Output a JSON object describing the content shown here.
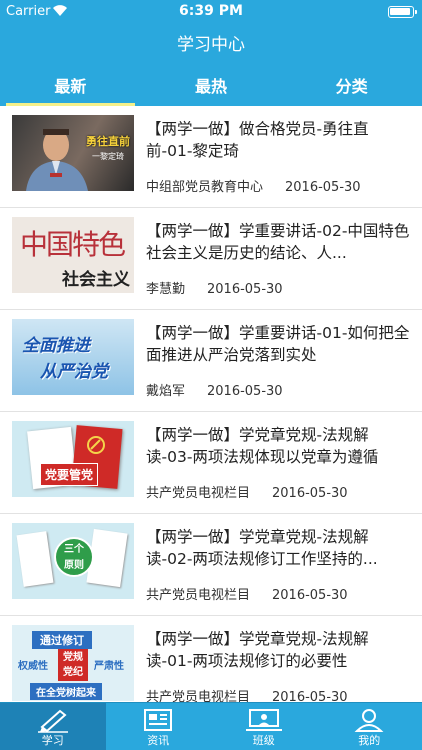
{
  "status_bar": {
    "carrier": "Carrier",
    "time": "6:39 PM"
  },
  "nav": {
    "title": "学习中心"
  },
  "tabs": [
    {
      "label": "最新",
      "active": true
    },
    {
      "label": "最热",
      "active": false
    },
    {
      "label": "分类",
      "active": false
    }
  ],
  "thumbnails": {
    "t1": {
      "text": "勇往直前",
      "sub": "一黎定琦"
    },
    "t2": {
      "text": "中国特色",
      "sub": "社会主义"
    },
    "t3": {
      "line1": "全面推进",
      "line2": "从严治党"
    },
    "t4": {
      "badge": "党要管党"
    },
    "t5": {
      "badge_top": "三个",
      "badge_bottom": "原则"
    },
    "t6": {
      "top": "通过修订",
      "left": "权威性",
      "center_top": "党规",
      "center_bottom": "党纪",
      "right": "严肃性",
      "bottom": "在全党树起来"
    }
  },
  "items": [
    {
      "title": "【两学一做】做合格党员-勇往直前-01-黎定琦",
      "source": "中组部党员教育中心",
      "date": "2016-05-30"
    },
    {
      "title": "【两学一做】学重要讲话-02-中国特色社会主义是历史的结论、人...",
      "source": "李慧勤",
      "date": "2016-05-30"
    },
    {
      "title": "【两学一做】学重要讲话-01-如何把全面推进从严治党落到实处",
      "source": "戴焰军",
      "date": "2016-05-30"
    },
    {
      "title": "【两学一做】学党章党规-法规解读-03-两项法规体现以党章为遵循",
      "source": "共产党员电视栏目",
      "date": "2016-05-30"
    },
    {
      "title": "【两学一做】学党章党规-法规解读-02-两项法规修订工作坚持的...",
      "source": "共产党员电视栏目",
      "date": "2016-05-30"
    },
    {
      "title": "【两学一做】学党章党规-法规解读-01-两项法规修订的必要性",
      "source": "共产党员电视栏目",
      "date": "2016-05-30"
    }
  ],
  "tabbar": [
    {
      "label": "学习",
      "icon": "pen-icon",
      "active": true
    },
    {
      "label": "资讯",
      "icon": "newspaper-icon",
      "active": false
    },
    {
      "label": "班级",
      "icon": "classroom-icon",
      "active": false
    },
    {
      "label": "我的",
      "icon": "profile-icon",
      "active": false
    }
  ],
  "colors": {
    "primary": "#2aa8dd",
    "tab_active": "#1e82b6",
    "tab_underline": "#f4f08a"
  }
}
